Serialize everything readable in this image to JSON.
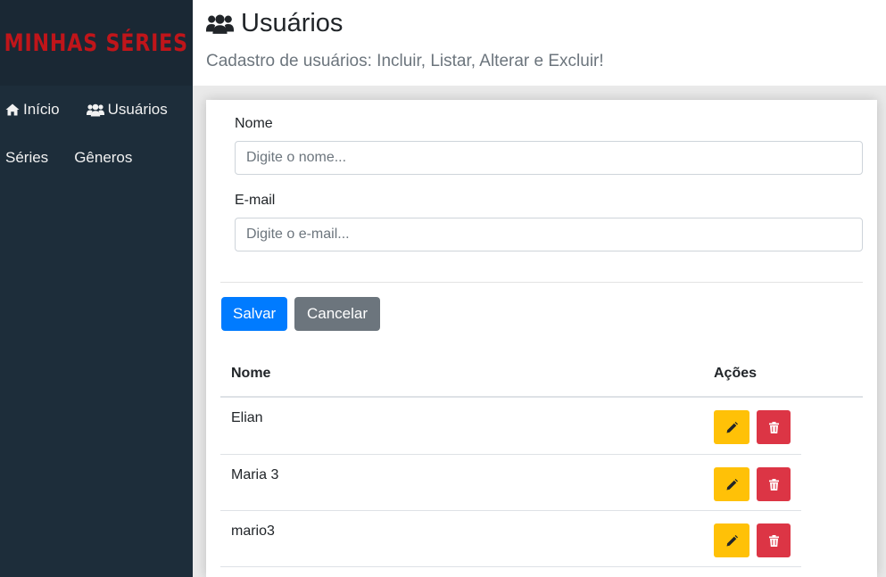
{
  "brand": {
    "logo": "MINHAS SÉRIES",
    "color": "#c0151a"
  },
  "nav": {
    "items": [
      {
        "label": "Início",
        "icon": "home-icon"
      },
      {
        "label": "Usuários",
        "icon": "users-icon"
      },
      {
        "label": "Séries",
        "icon": ""
      },
      {
        "label": "Gêneros",
        "icon": ""
      }
    ]
  },
  "header": {
    "title": "Usuários",
    "title_icon": "users-icon",
    "subtitle": "Cadastro de usuários: Incluir, Listar, Alterar e Excluir!"
  },
  "form": {
    "name_label": "Nome",
    "name_placeholder": "Digite o nome...",
    "name_value": "",
    "email_label": "E-mail",
    "email_placeholder": "Digite o e-mail...",
    "email_value": "",
    "save_label": "Salvar",
    "cancel_label": "Cancelar"
  },
  "table": {
    "headers": [
      "Nome",
      "Ações"
    ],
    "rows": [
      {
        "name": "Elian"
      },
      {
        "name": "Maria 3"
      },
      {
        "name": "mario3"
      }
    ],
    "edit_icon": "pencil-icon",
    "delete_icon": "trash-icon"
  },
  "colors": {
    "primary": "#007bff",
    "secondary": "#6c757d",
    "warning": "#ffc107",
    "danger": "#dc3545",
    "sidebar": "#1d2d3a"
  }
}
